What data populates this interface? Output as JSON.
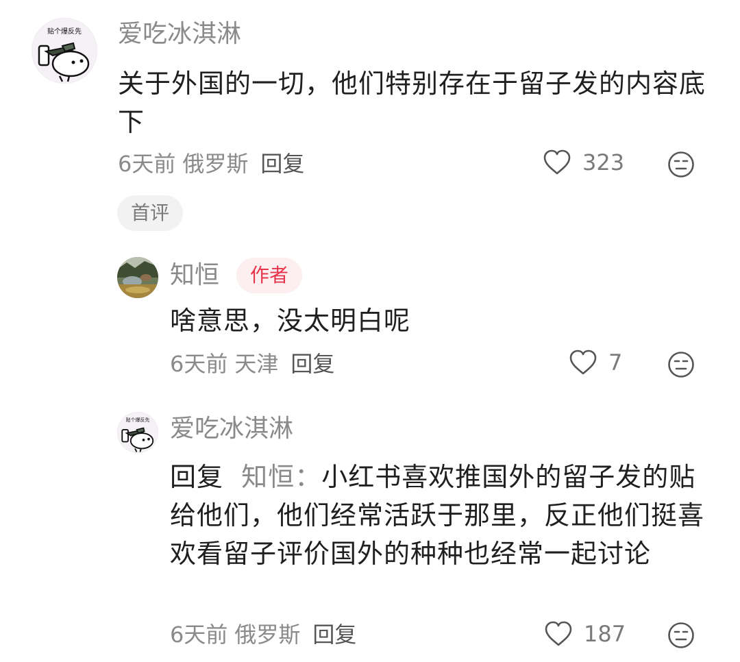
{
  "comments": [
    {
      "avatar_caption": "贴个爆反先",
      "username": "爱吃冰淇淋",
      "text": "关于外国的一切，他们特别存在于留子发的内容底下",
      "time": "6天前",
      "location": "俄罗斯",
      "reply_label": "回复",
      "likes": "323",
      "tag": "首评",
      "icons": [
        "heart-icon",
        "emoji-icon"
      ]
    },
    {
      "username": "知恒",
      "badge": "作者",
      "text": "啥意思，没太明白呢",
      "time": "6天前",
      "location": "天津",
      "reply_label": "回复",
      "likes": "7",
      "icons": [
        "heart-icon",
        "emoji-icon"
      ]
    },
    {
      "avatar_caption": "贴个爆反先",
      "username": "爱吃冰淇淋",
      "reply_prefix": "回复",
      "reply_target": "知恒：",
      "text": "小红书喜欢推国外的留子发的贴给他们，他们经常活跃于那里，反正他们挺喜欢看留子评价国外的种种也经常一起讨论",
      "time": "6天前",
      "location": "俄罗斯",
      "reply_label": "回复",
      "likes": "187",
      "icons": [
        "heart-icon",
        "emoji-icon"
      ]
    }
  ],
  "colors": {
    "username": "#8a8a8a",
    "body": "#1f1f1f",
    "badge_text": "#e8344a",
    "badge_bg": "#fdeef0",
    "tag_bg": "#f2f2f2"
  }
}
